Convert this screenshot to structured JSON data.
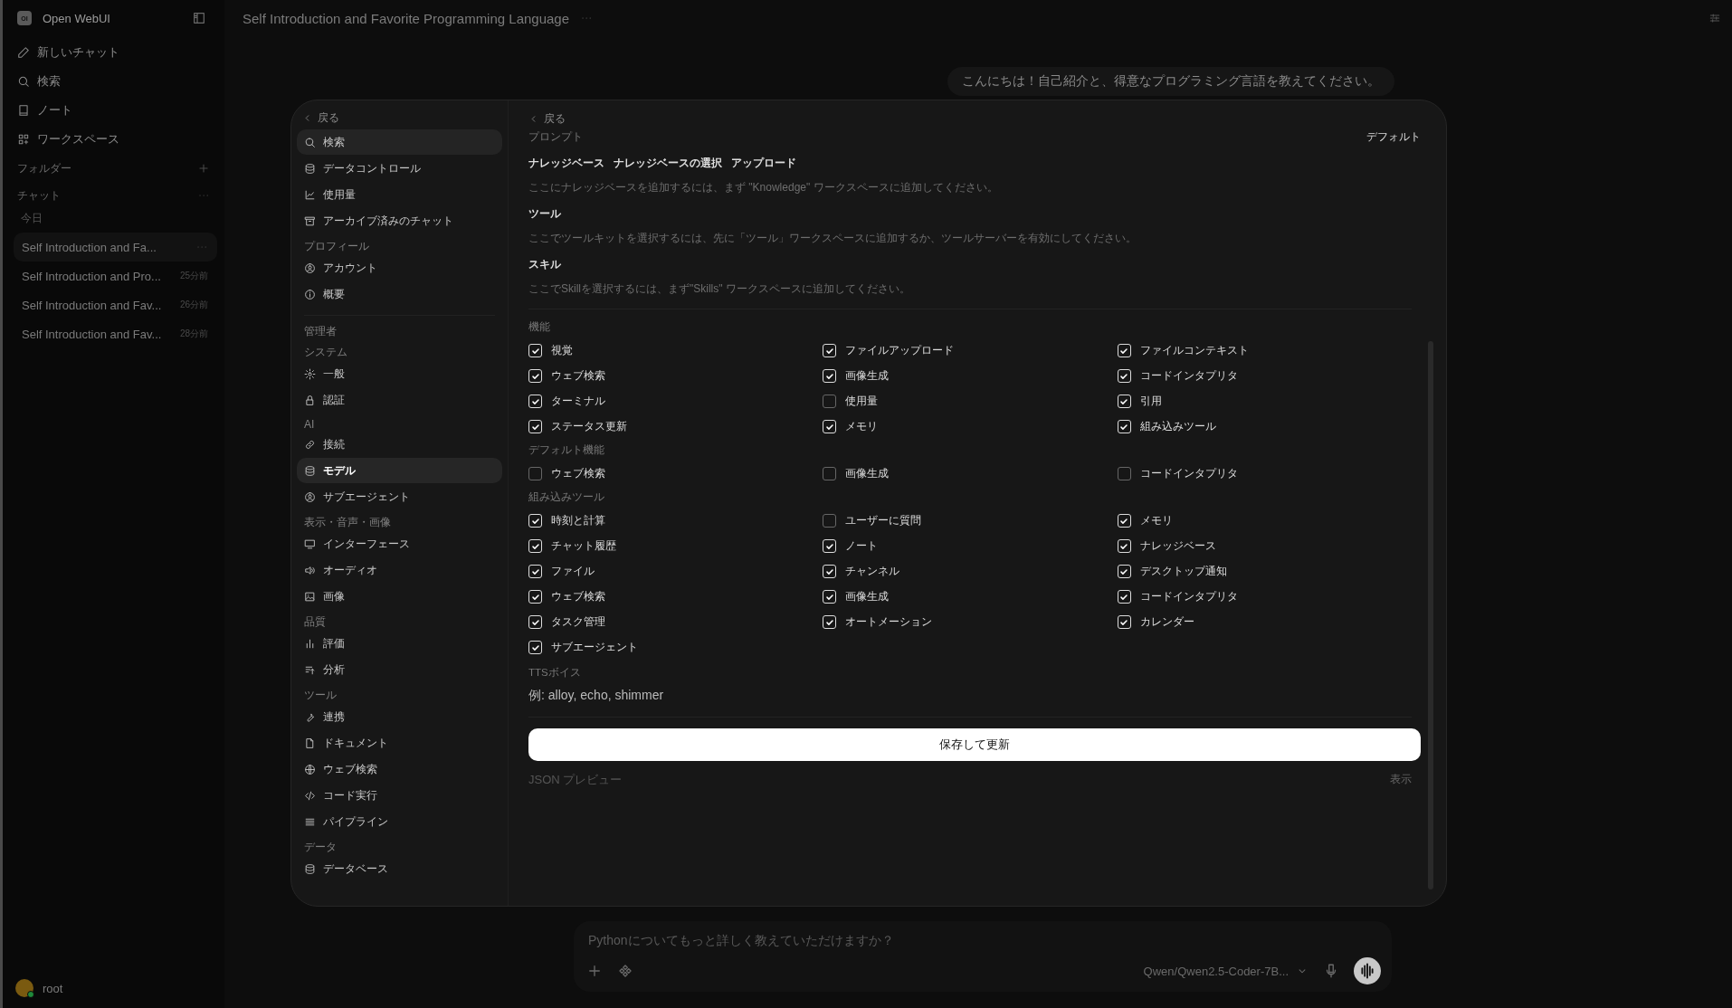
{
  "sidebar": {
    "logo": "OI",
    "app_name": "Open WebUI",
    "items": [
      {
        "label": "新しいチャット"
      },
      {
        "label": "検索"
      },
      {
        "label": "ノート"
      },
      {
        "label": "ワークスペース"
      }
    ],
    "folders_label": "フォルダー",
    "chats_label": "チャット",
    "date_group": "今日",
    "chats": [
      {
        "title": "Self Introduction and Fa...",
        "selected": true
      },
      {
        "title": "Self Introduction and Pro...",
        "time": "25分前",
        "selected": false
      },
      {
        "title": "Self Introduction and Fav...",
        "time": "26分前",
        "selected": false
      },
      {
        "title": "Self Introduction and Fav...",
        "time": "28分前",
        "selected": false
      }
    ],
    "user": {
      "name": "root"
    }
  },
  "header": {
    "title": "Self Introduction and Favorite Programming Language"
  },
  "messages": [
    {
      "text": "こんにちは！自己紹介と、得意なプログラミング言語を教えてください。"
    }
  ],
  "composer": {
    "placeholder": "Pythonについてもっと詳しく教えていただけますか？",
    "model": "Qwen/Qwen2.5-Coder-7B..."
  },
  "settings_modal": {
    "nav": {
      "back": "戻る",
      "groups": [
        {
          "items": [
            {
              "label": "検索",
              "selected": false,
              "highlighted": true
            },
            {
              "label": "データコントロール",
              "selected": false,
              "highlighted": false
            },
            {
              "label": "使用量",
              "selected": false,
              "highlighted": false
            },
            {
              "label": "アーカイブ済みのチャット",
              "selected": false,
              "highlighted": false
            }
          ]
        },
        {
          "heading": "プロフィール",
          "items": [
            {
              "label": "アカウント",
              "selected": false,
              "highlighted": false
            },
            {
              "label": "概要",
              "selected": false,
              "highlighted": false
            }
          ]
        },
        {
          "heading": "管理者"
        },
        {
          "heading": "システム",
          "items": [
            {
              "label": "一般",
              "selected": false,
              "highlighted": false
            },
            {
              "label": "認証",
              "selected": false,
              "highlighted": false
            }
          ]
        },
        {
          "heading": "AI",
          "items": [
            {
              "label": "接続",
              "selected": false,
              "highlighted": false
            },
            {
              "label": "モデル",
              "selected": true,
              "highlighted": false
            },
            {
              "label": "サブエージェント",
              "selected": false,
              "highlighted": false
            }
          ]
        },
        {
          "heading": "表示・音声・画像",
          "items": [
            {
              "label": "インターフェース",
              "selected": false,
              "highlighted": false
            },
            {
              "label": "オーディオ",
              "selected": false,
              "highlighted": false
            },
            {
              "label": "画像",
              "selected": false,
              "highlighted": false
            }
          ]
        },
        {
          "heading": "品質",
          "items": [
            {
              "label": "評価",
              "selected": false,
              "highlighted": false
            },
            {
              "label": "分析",
              "selected": false,
              "highlighted": false
            }
          ]
        },
        {
          "heading": "ツール",
          "items": [
            {
              "label": "連携",
              "selected": false,
              "highlighted": false
            },
            {
              "label": "ドキュメント",
              "selected": false,
              "highlighted": false
            },
            {
              "label": "ウェブ検索",
              "selected": false,
              "highlighted": false
            },
            {
              "label": "コード実行",
              "selected": false,
              "highlighted": false
            },
            {
              "label": "パイプライン",
              "selected": false,
              "highlighted": false
            }
          ]
        },
        {
          "heading": "データ",
          "items": [
            {
              "label": "データベース",
              "selected": false,
              "highlighted": false
            }
          ]
        }
      ]
    },
    "editor": {
      "back": "戻る",
      "prompt_label": "プロンプト",
      "prompt_mode": "デフォルト",
      "knowledge": {
        "label": "ナレッジベース",
        "select": "ナレッジベースの選択",
        "upload": "アップロード",
        "hint": "ここにナレッジベースを追加するには、まず \"Knowledge\" ワークスペースに追加してください。"
      },
      "tools": {
        "label": "ツール",
        "hint": "ここでツールキットを選択するには、先に「ツール」ワークスペースに追加するか、ツールサーバーを有効にしてください。"
      },
      "skills": {
        "label": "スキル",
        "hint": "ここでSkillを選択するには、まず\"Skills\" ワークスペースに追加してください。"
      },
      "feature_groups": [
        {
          "label": "機能",
          "options": [
            {
              "label": "視覚",
              "checked": true
            },
            {
              "label": "ファイルアップロード",
              "checked": true
            },
            {
              "label": "ファイルコンテキスト",
              "checked": true
            },
            {
              "label": "ウェブ検索",
              "checked": true
            },
            {
              "label": "画像生成",
              "checked": true
            },
            {
              "label": "コードインタプリタ",
              "checked": true
            },
            {
              "label": "ターミナル",
              "checked": true
            },
            {
              "label": "使用量",
              "checked": false
            },
            {
              "label": "引用",
              "checked": true
            },
            {
              "label": "ステータス更新",
              "checked": true
            },
            {
              "label": "メモリ",
              "checked": true
            },
            {
              "label": "組み込みツール",
              "checked": true
            }
          ]
        },
        {
          "label": "デフォルト機能",
          "options": [
            {
              "label": "ウェブ検索",
              "checked": false
            },
            {
              "label": "画像生成",
              "checked": false
            },
            {
              "label": "コードインタプリタ",
              "checked": false
            }
          ]
        },
        {
          "label": "組み込みツール",
          "options": [
            {
              "label": "時刻と計算",
              "checked": true
            },
            {
              "label": "ユーザーに質問",
              "checked": false
            },
            {
              "label": "メモリ",
              "checked": true
            },
            {
              "label": "チャット履歴",
              "checked": true
            },
            {
              "label": "ノート",
              "checked": true
            },
            {
              "label": "ナレッジベース",
              "checked": true
            },
            {
              "label": "ファイル",
              "checked": true
            },
            {
              "label": "チャンネル",
              "checked": true
            },
            {
              "label": "デスクトップ通知",
              "checked": true
            },
            {
              "label": "ウェブ検索",
              "checked": true
            },
            {
              "label": "画像生成",
              "checked": true
            },
            {
              "label": "コードインタプリタ",
              "checked": true
            },
            {
              "label": "タスク管理",
              "checked": true
            },
            {
              "label": "オートメーション",
              "checked": true
            },
            {
              "label": "カレンダー",
              "checked": true
            },
            {
              "label": "サブエージェント",
              "checked": true
            }
          ]
        }
      ],
      "tts": {
        "label": "TTSボイス",
        "placeholder": "例: alloy, echo, shimmer"
      },
      "save": "保存して更新",
      "json_preview": {
        "label": "JSON プレビュー",
        "toggle": "表示"
      }
    }
  }
}
